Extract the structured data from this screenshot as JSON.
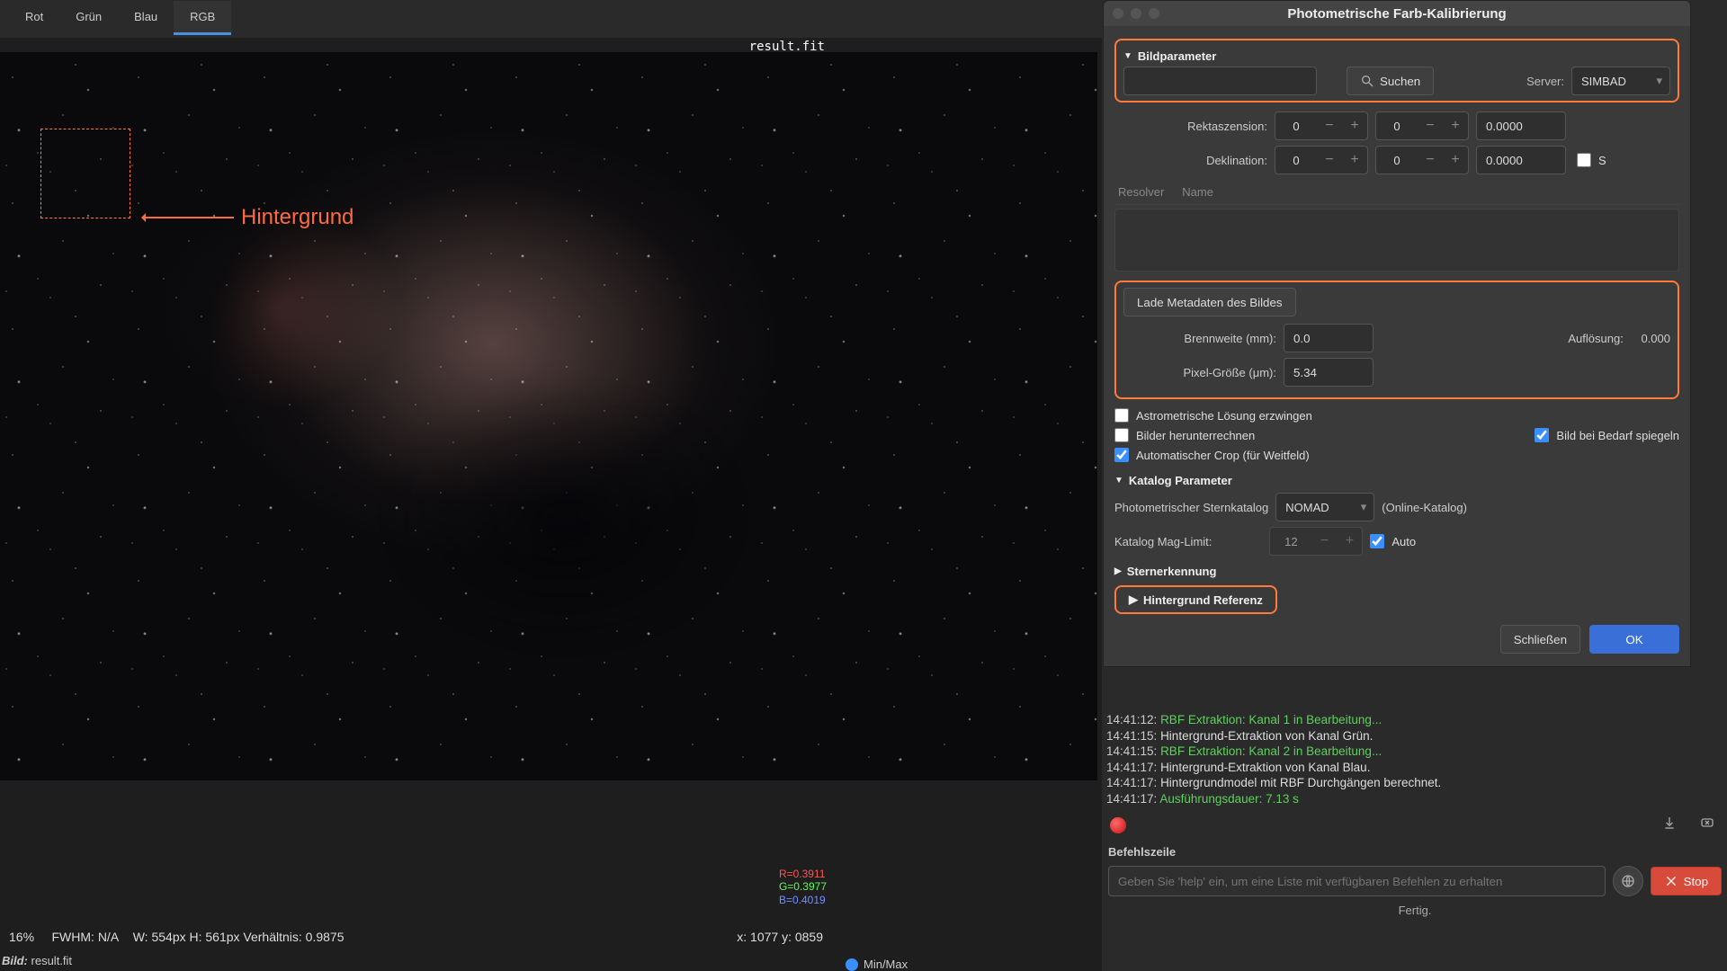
{
  "tabs": [
    "Rot",
    "Grün",
    "Blau",
    "RGB"
  ],
  "active_tab_index": 3,
  "image": {
    "filename": "result.fit",
    "annotation": "Hintergrund"
  },
  "rgb_stats": {
    "r": "R=0.3911",
    "g": "G=0.3977",
    "b": "B=0.4019"
  },
  "status": {
    "zoom": "16%",
    "fwhm_label": "FWHM:",
    "fwhm_value": "N/A",
    "dims": "W: 554px H: 561px Verhältnis: 0.9875",
    "cursor": "x: 1077 y: 0859",
    "file_prefix": "Bild:",
    "file_name": "result.fit"
  },
  "dialog": {
    "title": "Photometrische Farb-Kalibrierung",
    "sections": {
      "image_params": "Bildparameter",
      "catalog_params": "Katalog Parameter",
      "star_detection": "Sternerkennung",
      "bg_reference": "Hintergrund Referenz"
    },
    "search": {
      "button": "Suchen"
    },
    "server": {
      "label": "Server:",
      "value": "SIMBAD"
    },
    "ra": {
      "label": "Rektaszension:",
      "h": "0",
      "m": "0",
      "deg": "0.0000"
    },
    "dec": {
      "label": "Deklination:",
      "d": "0",
      "m": "0",
      "deg": "0.0000",
      "s_suffix": "S"
    },
    "list": {
      "col_resolver": "Resolver",
      "col_name": "Name"
    },
    "meta_button": "Lade Metadaten des Bildes",
    "focal": {
      "label": "Brennweite (mm):",
      "value": "0.0"
    },
    "pixel": {
      "label": "Pixel-Größe (μm):",
      "value": "5.34"
    },
    "resolution": {
      "label": "Auflösung:",
      "value": "0.000"
    },
    "options": {
      "force_astrometry": "Astrometrische Lösung erzwingen",
      "downsample": "Bilder herunterrechnen",
      "flip": "Bild bei Bedarf spiegeln",
      "autocrop": "Automatischer Crop (für Weitfeld)"
    },
    "catalog": {
      "label": "Photometrischer Sternkatalog",
      "value": "NOMAD",
      "hint": "(Online-Katalog)"
    },
    "maglimit": {
      "label": "Katalog Mag-Limit:",
      "value": "12",
      "auto": "Auto"
    },
    "buttons": {
      "close": "Schließen",
      "ok": "OK"
    }
  },
  "log": [
    {
      "ts": "14:41:12:",
      "cls": "green",
      "text": "RBF Extraktion: Kanal 1 in Bearbeitung..."
    },
    {
      "ts": "14:41:15:",
      "cls": "white",
      "text": "Hintergrund-Extraktion von Kanal Grün."
    },
    {
      "ts": "14:41:15:",
      "cls": "green",
      "text": "RBF Extraktion: Kanal 2 in Bearbeitung..."
    },
    {
      "ts": "14:41:17:",
      "cls": "white",
      "text": "Hintergrund-Extraktion von Kanal Blau."
    },
    {
      "ts": "14:41:17:",
      "cls": "white",
      "text": "Hintergrundmodel mit RBF Durchgängen berechnet."
    },
    {
      "ts": "14:41:17:",
      "cls": "green",
      "text": "Ausführungsdauer: 7.13 s"
    }
  ],
  "cmd": {
    "label": "Befehlszeile",
    "placeholder": "Geben Sie 'help' ein, um eine Liste mit verfügbaren Befehlen zu erhalten",
    "stop": "Stop",
    "ready": "Fertig."
  },
  "minmax": "Min/Max"
}
